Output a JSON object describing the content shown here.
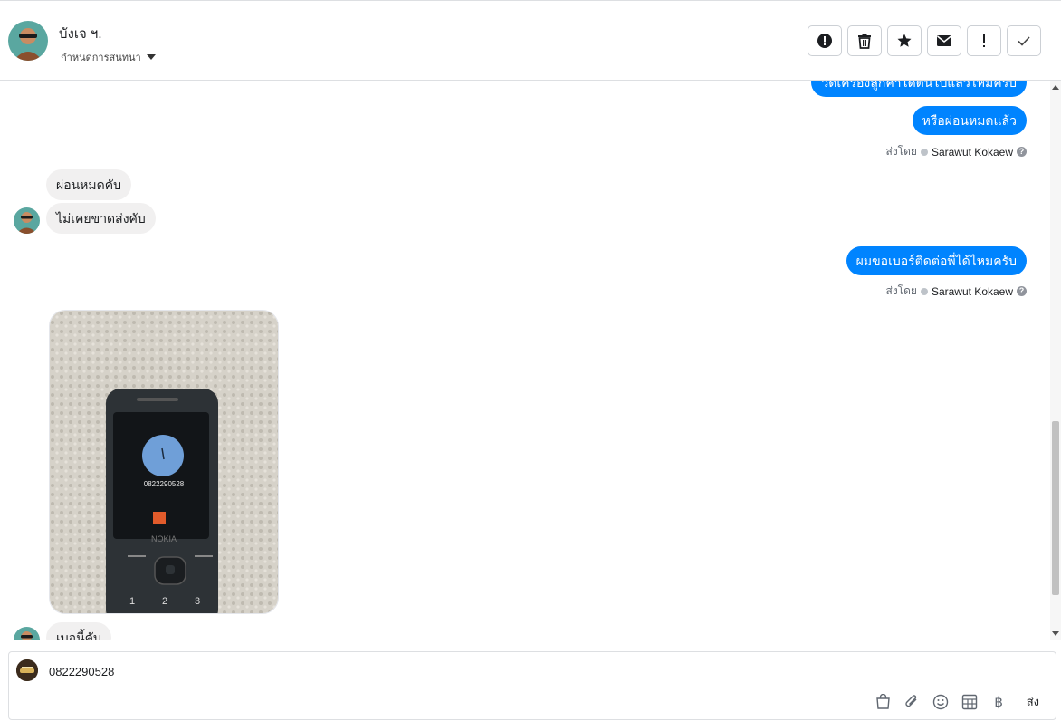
{
  "header": {
    "contact_name": "บังเจ ฯ.",
    "label_select": "กำหนดการสนทนา",
    "actions": [
      "spam",
      "delete",
      "star",
      "mark-unread",
      "important",
      "done"
    ]
  },
  "thread": {
    "partial_top_message": "วัดเครื่องลูกค้าได้ต้นไปแล้วไหมครับ",
    "messages": [
      {
        "dir": "out",
        "text": "หรือผ่อนหมดแล้ว"
      },
      {
        "dir": "in",
        "text": "ผ่อนหมดคับ"
      },
      {
        "dir": "in",
        "text": "ไม่เคยขาดส่งคับ"
      },
      {
        "dir": "out",
        "text": "ผมขอเบอร์ติดต่อพี่ได้ไหมครับ"
      },
      {
        "dir": "in",
        "text": "เบอนี้คับ"
      }
    ],
    "sender_prefix": "ส่งโดย",
    "sender_name": "Sarawut Kokaew",
    "photo": {
      "phone_brand": "NOKIA",
      "phone_number": "0822290528"
    }
  },
  "composer": {
    "value": "0822290528",
    "send_label": "ส่ง",
    "tools": [
      "shop-icon",
      "attach-icon",
      "emoji-icon",
      "table-icon",
      "baht-icon"
    ]
  },
  "colors": {
    "outgoing_bubble": "#0084ff",
    "incoming_bubble": "#f1f0f0"
  }
}
